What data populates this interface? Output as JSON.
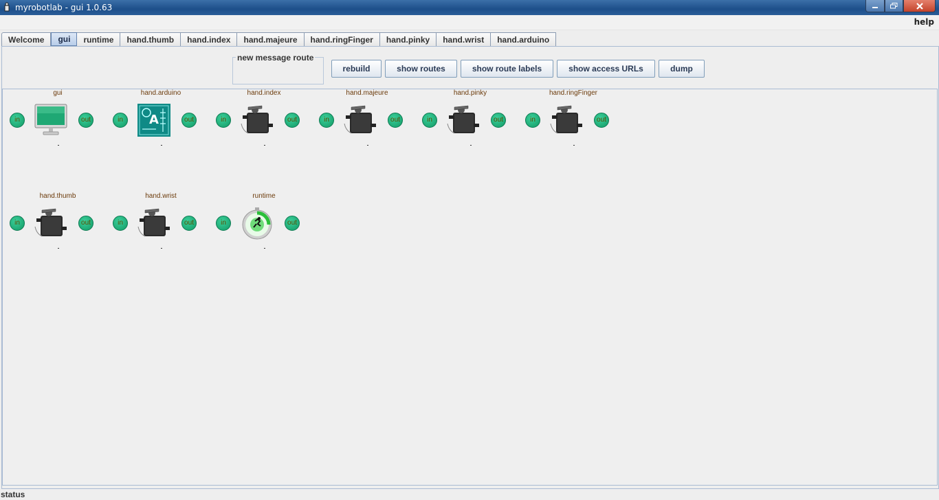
{
  "window": {
    "title": "myrobotlab - gui 1.0.63"
  },
  "menu": {
    "help": "help"
  },
  "tabs": [
    "Welcome",
    "gui",
    "runtime",
    "hand.thumb",
    "hand.index",
    "hand.majeure",
    "hand.ringFinger",
    "hand.pinky",
    "hand.wrist",
    "hand.arduino"
  ],
  "active_tab": "gui",
  "toolbar": {
    "route_legend": "new message route",
    "rebuild": "rebuild",
    "show_routes": "show routes",
    "show_route_labels": "show route labels",
    "show_access_urls": "show access URLs",
    "dump": "dump"
  },
  "ports": {
    "in": "in",
    "out": "out"
  },
  "nodes": [
    {
      "name": "gui",
      "icon": "monitor-icon",
      "dot": "."
    },
    {
      "name": "hand.arduino",
      "icon": "arduino-icon",
      "dot": "."
    },
    {
      "name": "hand.index",
      "icon": "servo-icon",
      "dot": "."
    },
    {
      "name": "hand.majeure",
      "icon": "servo-icon",
      "dot": "."
    },
    {
      "name": "hand.pinky",
      "icon": "servo-icon",
      "dot": "."
    },
    {
      "name": "hand.ringFinger",
      "icon": "servo-icon",
      "dot": "."
    },
    {
      "name": "hand.thumb",
      "icon": "servo-icon",
      "dot": "."
    },
    {
      "name": "hand.wrist",
      "icon": "servo-icon",
      "dot": "."
    },
    {
      "name": "runtime",
      "icon": "runtime-icon",
      "dot": "."
    }
  ],
  "status": "status",
  "colors": {
    "port": "#1aae77",
    "label": "#6b3a0a",
    "titlebar": "#1d4f8a"
  }
}
